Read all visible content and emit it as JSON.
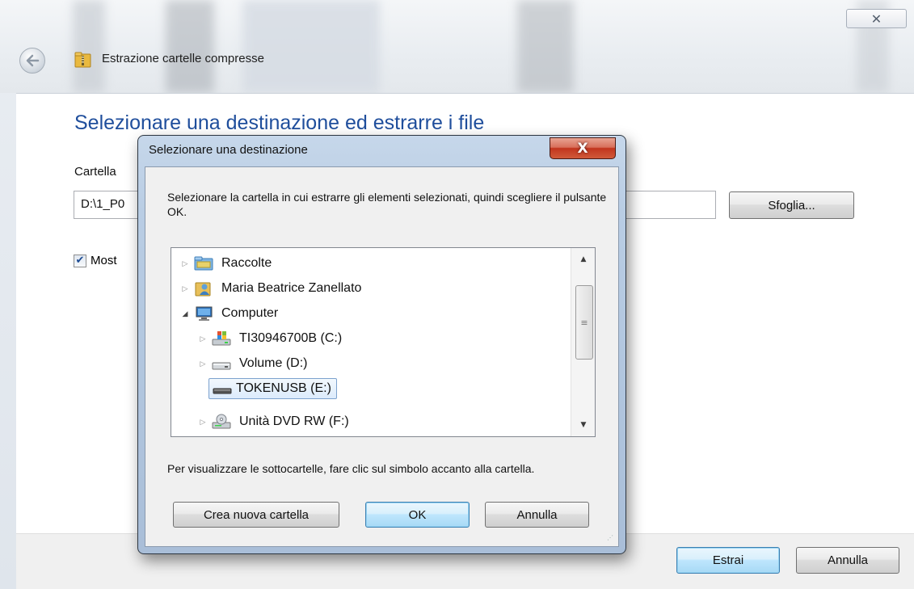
{
  "wizard": {
    "close_glyph": "✕",
    "title": "Estrazione cartelle compresse",
    "heading": "Selezionare una destinazione ed estrarre i file",
    "dest_label": "Cartella",
    "dest_value": "D:\\1_P0",
    "browse_label": "Sfoglia...",
    "show_label": "Most",
    "show_checked": true,
    "extract_label": "Estrai",
    "cancel_label": "Annulla"
  },
  "dialog": {
    "title": "Selezionare una destinazione",
    "close_glyph": "X",
    "instructions": "Selezionare la cartella in cui estrarre gli elementi selezionati, quindi scegliere il pulsante OK.",
    "tree": [
      {
        "label": "Raccolte",
        "expander": "▷",
        "icon": "libraries-icon",
        "selected": false
      },
      {
        "label": "Maria Beatrice Zanellato",
        "expander": "▷",
        "icon": "user-folder-icon",
        "selected": false
      },
      {
        "label": "Computer",
        "expander": "◢",
        "icon": "computer-icon",
        "selected": false
      },
      {
        "label": "TI30946700B (C:)",
        "expander": "▷",
        "icon": "system-drive-icon",
        "selected": false
      },
      {
        "label": "Volume (D:)",
        "expander": "▷",
        "icon": "hard-drive-icon",
        "selected": false
      },
      {
        "label": "TOKENUSB (E:)",
        "expander": "",
        "icon": "usb-drive-icon",
        "selected": true
      },
      {
        "label": "Unità DVD RW (F:)",
        "expander": "▷",
        "icon": "dvd-drive-icon",
        "selected": false
      }
    ],
    "hint": "Per visualizzare le sottocartelle, fare clic sul simbolo accanto alla cartella.",
    "new_folder_label": "Crea nuova cartella",
    "ok_label": "OK",
    "cancel_label": "Annulla"
  }
}
